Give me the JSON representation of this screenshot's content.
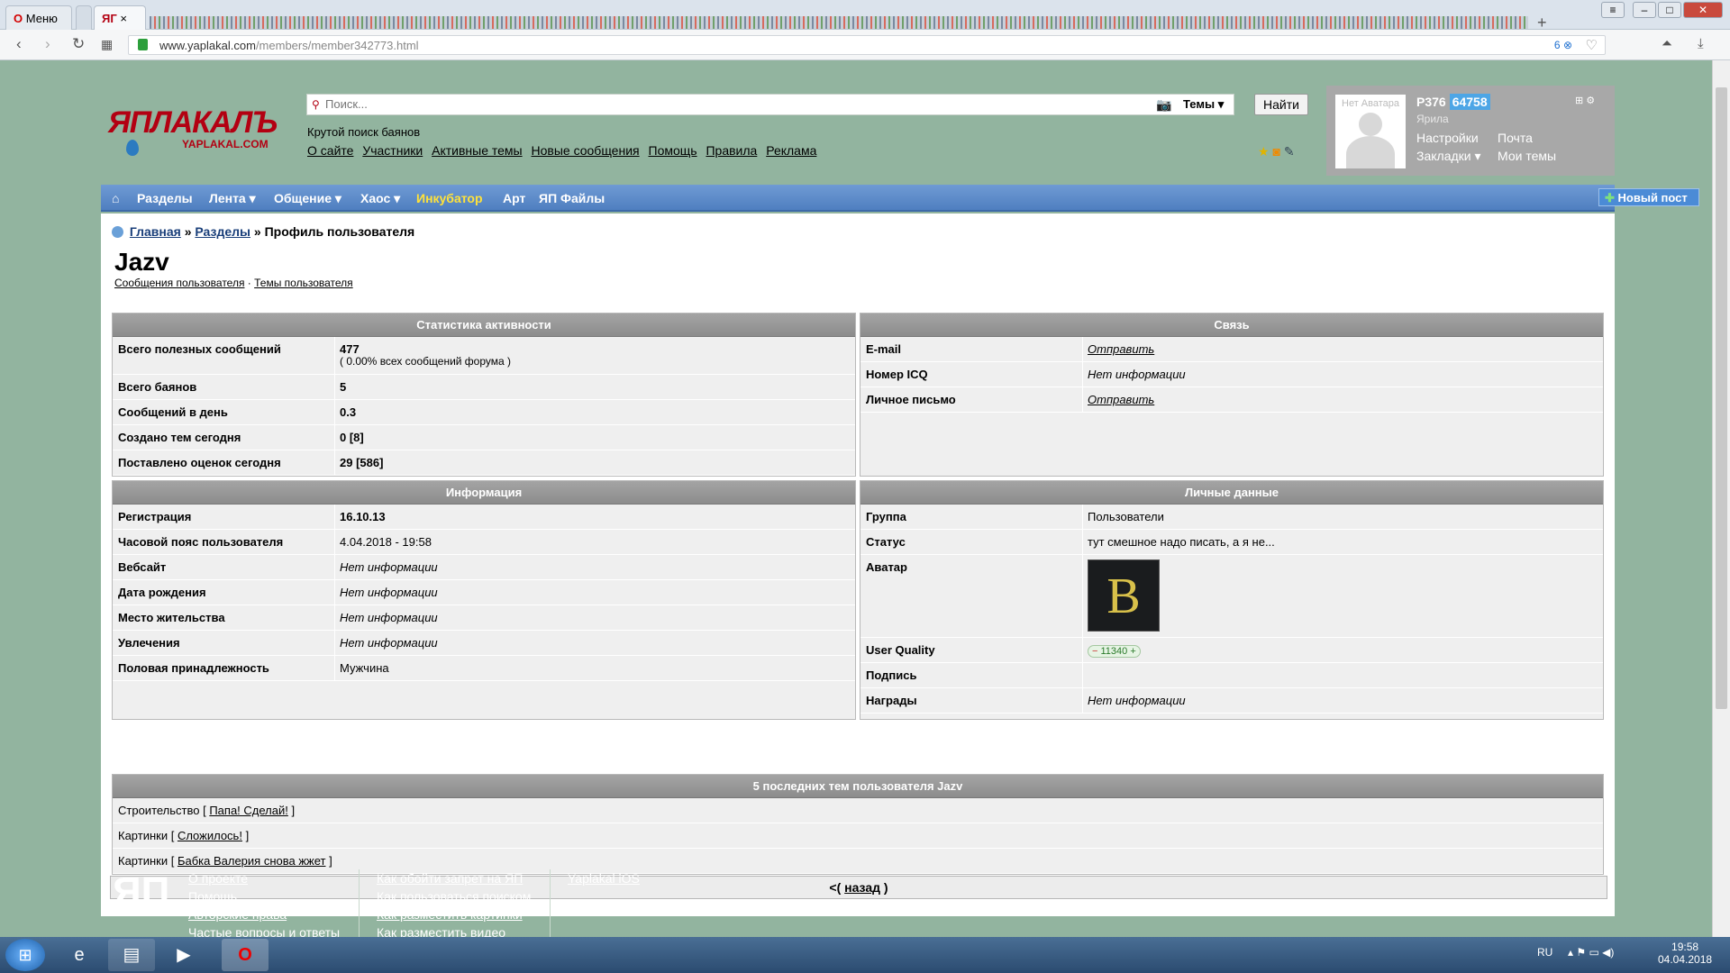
{
  "browser": {
    "menu_label": "Меню",
    "active_tab_label": "ЯГ",
    "url_host": "www.yaplakal.com",
    "url_path": "/members/member342773.html",
    "badge_count": "6"
  },
  "site": {
    "logo_text": "ЯПЛАКАЛЪ",
    "logo_sub": "YAPLAKAL.COM",
    "search_placeholder": "Поиск...",
    "search_scope": "Темы",
    "find_button": "Найти",
    "tagline": "Крутой поиск баянов",
    "top_links": [
      "О сайте",
      "Участники",
      "Активные темы",
      "Новые сообщения",
      "Помощь",
      "Правила",
      "Реклама"
    ]
  },
  "user_box": {
    "no_avatar": "Нет Аватара",
    "username": "P376",
    "karma": "64758",
    "group": "Ярила",
    "settings": "Настройки",
    "mail": "Почта",
    "bookmarks": "Закладки",
    "my_topics": "Мои темы"
  },
  "nav": {
    "items": [
      "Разделы",
      "Лента",
      "Общение",
      "Хаос",
      "Инкубатор",
      "Арт",
      "ЯП Файлы"
    ],
    "new_post": "Новый пост"
  },
  "breadcrumb": {
    "home": "Главная",
    "sections": "Разделы",
    "current": "Профиль пользователя"
  },
  "profile": {
    "name": "Jazv",
    "messages_link": "Сообщения пользователя",
    "topics_link": "Темы пользователя"
  },
  "activity": {
    "title": "Статистика активности",
    "rows": [
      {
        "k": "Всего полезных сообщений",
        "v": "477",
        "v2": "( 0.00% всех сообщений форума )"
      },
      {
        "k": "Всего баянов",
        "v": "5"
      },
      {
        "k": "Сообщений в день",
        "v": "0.3"
      },
      {
        "k": "Создано тем сегодня",
        "v": "0 [8]"
      },
      {
        "k": "Поставлено оценок сегодня",
        "v": "29 [586]"
      }
    ]
  },
  "contact": {
    "title": "Связь",
    "rows": [
      {
        "k": "E-mail",
        "v": "Отправить"
      },
      {
        "k": "Номер ICQ",
        "v": "Нет информации"
      },
      {
        "k": "Личное письмо",
        "v": "Отправить"
      }
    ]
  },
  "info": {
    "title": "Информация",
    "rows": [
      {
        "k": "Регистрация",
        "v": "16.10.13"
      },
      {
        "k": "Часовой пояс пользователя",
        "v": "4.04.2018 - 19:58"
      },
      {
        "k": "Вебсайт",
        "v": "Нет информации"
      },
      {
        "k": "Дата рождения",
        "v": "Нет информации"
      },
      {
        "k": "Место жительства",
        "v": "Нет информации"
      },
      {
        "k": "Увлечения",
        "v": "Нет информации"
      },
      {
        "k": "Половая принадлежность",
        "v": "Мужчина"
      }
    ]
  },
  "personal": {
    "title": "Личные данные",
    "rows": [
      {
        "k": "Группа",
        "v": "Пользователи"
      },
      {
        "k": "Статус",
        "v": "тут смешное надо писать, а я не..."
      },
      {
        "k": "Аватар",
        "v": "B"
      },
      {
        "k": "User Quality",
        "v": "11340"
      },
      {
        "k": "Подпись",
        "v": ""
      },
      {
        "k": "Награды",
        "v": "Нет информации"
      }
    ]
  },
  "recent": {
    "title": "5 последних тем пользователя Jazv",
    "rows": [
      {
        "section": "Строительство",
        "topic": "Папа! Сделай!"
      },
      {
        "section": "Картинки",
        "topic": "Сложилось!"
      },
      {
        "section": "Картинки",
        "topic": "Бабка Валерия снова жжет"
      }
    ]
  },
  "back": {
    "prefix": "<(",
    "link": "назад",
    "suffix": ")"
  },
  "footer": {
    "logo": "ЯП",
    "col1": [
      "О проекте",
      "Помощь",
      "Авторские права",
      "Частые вопросы и ответы"
    ],
    "col2": [
      "Как обойти запрет на ЯП",
      "Как пользоваться поиском",
      "Как разместить картинки",
      "Как разместить видео"
    ],
    "col3": [
      "Yaplakal iOS"
    ]
  },
  "taskbar": {
    "lang": "RU",
    "time": "19:58",
    "date": "04.04.2018"
  }
}
